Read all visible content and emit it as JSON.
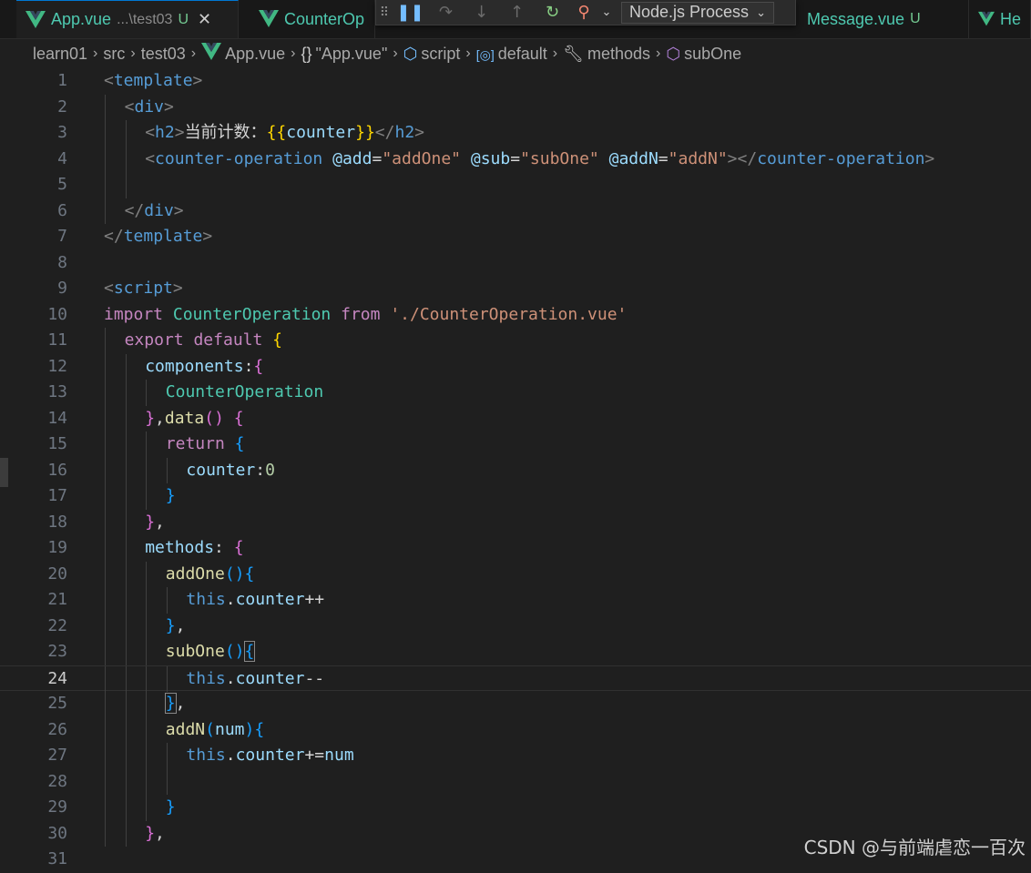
{
  "tabs": [
    {
      "label": "App.vue",
      "path": "...\\test03",
      "status": "U",
      "active": true
    },
    {
      "label": "CounterOp",
      "path": "",
      "status": "",
      "active": false
    },
    {
      "label": "Message.vue",
      "path": "",
      "status": "U",
      "active": false
    },
    {
      "label": "He",
      "path": "",
      "status": "",
      "active": false
    }
  ],
  "debug": {
    "process": "Node.js Process"
  },
  "breadcrumb": [
    {
      "icon": "folder",
      "label": "learn01"
    },
    {
      "icon": "folder",
      "label": "src"
    },
    {
      "icon": "folder",
      "label": "test03"
    },
    {
      "icon": "vue-icon",
      "label": "App.vue"
    },
    {
      "icon": "braces-icon",
      "label": "\"App.vue\""
    },
    {
      "icon": "cube-icon",
      "label": "script"
    },
    {
      "icon": "module-icon",
      "label": "default"
    },
    {
      "icon": "wrench-icon",
      "label": "methods"
    },
    {
      "icon": "method-icon",
      "label": "subOne"
    }
  ],
  "current_line": 24,
  "lines": [
    {
      "n": "1",
      "indent": 0,
      "tokens": [
        [
          "t-tag",
          "<"
        ],
        [
          "t-tagname",
          "template"
        ],
        [
          "t-tag",
          ">"
        ]
      ]
    },
    {
      "n": "2",
      "indent": 1,
      "tokens": [
        [
          "t-tag",
          "<"
        ],
        [
          "t-tagname",
          "div"
        ],
        [
          "t-tag",
          ">"
        ]
      ]
    },
    {
      "n": "3",
      "indent": 2,
      "tokens": [
        [
          "t-tag",
          "<"
        ],
        [
          "t-tagname",
          "h2"
        ],
        [
          "t-tag",
          ">"
        ],
        [
          "t-plain",
          "当前计数："
        ],
        [
          "t-b1",
          "{{"
        ],
        [
          "t-ident",
          "counter"
        ],
        [
          "t-b1",
          "}}"
        ],
        [
          "t-tag",
          "</"
        ],
        [
          "t-tagname",
          "h2"
        ],
        [
          "t-tag",
          ">"
        ]
      ]
    },
    {
      "n": "4",
      "indent": 2,
      "tokens": [
        [
          "t-tag",
          "<"
        ],
        [
          "t-tagname",
          "counter-operation"
        ],
        [
          "t-plain",
          " "
        ],
        [
          "t-attr",
          "@add"
        ],
        [
          "t-plain",
          "="
        ],
        [
          "t-str",
          "\"addOne\""
        ],
        [
          "t-plain",
          " "
        ],
        [
          "t-attr",
          "@sub"
        ],
        [
          "t-plain",
          "="
        ],
        [
          "t-str",
          "\"subOne\""
        ],
        [
          "t-plain",
          " "
        ],
        [
          "t-attr",
          "@addN"
        ],
        [
          "t-plain",
          "="
        ],
        [
          "t-str",
          "\"addN\""
        ],
        [
          "t-tag",
          "></"
        ],
        [
          "t-tagname",
          "counter-operation"
        ],
        [
          "t-tag",
          ">"
        ]
      ]
    },
    {
      "n": "5",
      "indent": 2,
      "tokens": []
    },
    {
      "n": "6",
      "indent": 1,
      "tokens": [
        [
          "t-tag",
          "</"
        ],
        [
          "t-tagname",
          "div"
        ],
        [
          "t-tag",
          ">"
        ]
      ]
    },
    {
      "n": "7",
      "indent": 0,
      "tokens": [
        [
          "t-tag",
          "</"
        ],
        [
          "t-tagname",
          "template"
        ],
        [
          "t-tag",
          ">"
        ]
      ]
    },
    {
      "n": "8",
      "indent": 0,
      "tokens": []
    },
    {
      "n": "9",
      "indent": 0,
      "tokens": [
        [
          "t-tag",
          "<"
        ],
        [
          "t-tagname",
          "script"
        ],
        [
          "t-tag",
          ">"
        ]
      ]
    },
    {
      "n": "10",
      "indent": 0,
      "tokens": [
        [
          "t-kw",
          "import"
        ],
        [
          "t-plain",
          " "
        ],
        [
          "t-cls",
          "CounterOperation"
        ],
        [
          "t-plain",
          " "
        ],
        [
          "t-kw",
          "from"
        ],
        [
          "t-plain",
          " "
        ],
        [
          "t-str",
          "'./CounterOperation.vue'"
        ]
      ]
    },
    {
      "n": "11",
      "indent": 1,
      "tokens": [
        [
          "t-kw",
          "export"
        ],
        [
          "t-plain",
          " "
        ],
        [
          "t-kw",
          "default"
        ],
        [
          "t-plain",
          " "
        ],
        [
          "t-b1",
          "{"
        ]
      ]
    },
    {
      "n": "12",
      "indent": 2,
      "tokens": [
        [
          "t-ident",
          "components"
        ],
        [
          "t-plain",
          ":"
        ],
        [
          "t-b2",
          "{"
        ]
      ]
    },
    {
      "n": "13",
      "indent": 3,
      "tokens": [
        [
          "t-cls",
          "CounterOperation"
        ]
      ]
    },
    {
      "n": "14",
      "indent": 2,
      "tokens": [
        [
          "t-b2",
          "}"
        ],
        [
          "t-plain",
          ","
        ],
        [
          "t-fn",
          "data"
        ],
        [
          "t-b2",
          "()"
        ],
        [
          "t-plain",
          " "
        ],
        [
          "t-b2",
          "{"
        ]
      ]
    },
    {
      "n": "15",
      "indent": 3,
      "tokens": [
        [
          "t-kw",
          "return"
        ],
        [
          "t-plain",
          " "
        ],
        [
          "t-b3",
          "{"
        ]
      ]
    },
    {
      "n": "16",
      "indent": 4,
      "tokens": [
        [
          "t-ident",
          "counter"
        ],
        [
          "t-plain",
          ":"
        ],
        [
          "t-num",
          "0"
        ]
      ]
    },
    {
      "n": "17",
      "indent": 3,
      "tokens": [
        [
          "t-b3",
          "}"
        ]
      ]
    },
    {
      "n": "18",
      "indent": 2,
      "tokens": [
        [
          "t-b2",
          "}"
        ],
        [
          "t-plain",
          ","
        ]
      ]
    },
    {
      "n": "19",
      "indent": 2,
      "tokens": [
        [
          "t-ident",
          "methods"
        ],
        [
          "t-plain",
          ": "
        ],
        [
          "t-b2",
          "{"
        ]
      ]
    },
    {
      "n": "20",
      "indent": 3,
      "tokens": [
        [
          "t-fn",
          "addOne"
        ],
        [
          "t-b3",
          "(){"
        ]
      ]
    },
    {
      "n": "21",
      "indent": 4,
      "tokens": [
        [
          "t-this",
          "this"
        ],
        [
          "t-plain",
          "."
        ],
        [
          "t-ident",
          "counter"
        ],
        [
          "t-plain",
          "++"
        ]
      ]
    },
    {
      "n": "22",
      "indent": 3,
      "tokens": [
        [
          "t-b3",
          "}"
        ],
        [
          "t-plain",
          ","
        ]
      ]
    },
    {
      "n": "23",
      "indent": 3,
      "tokens": [
        [
          "t-fn",
          "subOne"
        ],
        [
          "t-b3",
          "()"
        ],
        [
          "t-b3 t-brh",
          "{"
        ]
      ]
    },
    {
      "n": "24",
      "indent": 4,
      "tokens": [
        [
          "t-this",
          "this"
        ],
        [
          "t-plain",
          "."
        ],
        [
          "t-ident",
          "counter"
        ],
        [
          "t-plain",
          "--"
        ]
      ]
    },
    {
      "n": "25",
      "indent": 3,
      "tokens": [
        [
          "t-b3 t-brh",
          "}"
        ],
        [
          "t-plain",
          ","
        ]
      ]
    },
    {
      "n": "26",
      "indent": 3,
      "tokens": [
        [
          "t-fn",
          "addN"
        ],
        [
          "t-b3",
          "("
        ],
        [
          "t-ident",
          "num"
        ],
        [
          "t-b3",
          "){"
        ]
      ]
    },
    {
      "n": "27",
      "indent": 4,
      "tokens": [
        [
          "t-this",
          "this"
        ],
        [
          "t-plain",
          "."
        ],
        [
          "t-ident",
          "counter"
        ],
        [
          "t-plain",
          "+="
        ],
        [
          "t-ident",
          "num"
        ]
      ]
    },
    {
      "n": "28",
      "indent": 4,
      "tokens": []
    },
    {
      "n": "29",
      "indent": 3,
      "tokens": [
        [
          "t-b3",
          "}"
        ]
      ]
    },
    {
      "n": "30",
      "indent": 2,
      "tokens": [
        [
          "t-b2",
          "}"
        ],
        [
          "t-plain",
          ","
        ]
      ]
    },
    {
      "n": "31",
      "indent": 0,
      "tokens": []
    }
  ],
  "watermark": "CSDN @与前端虐恋一百次"
}
